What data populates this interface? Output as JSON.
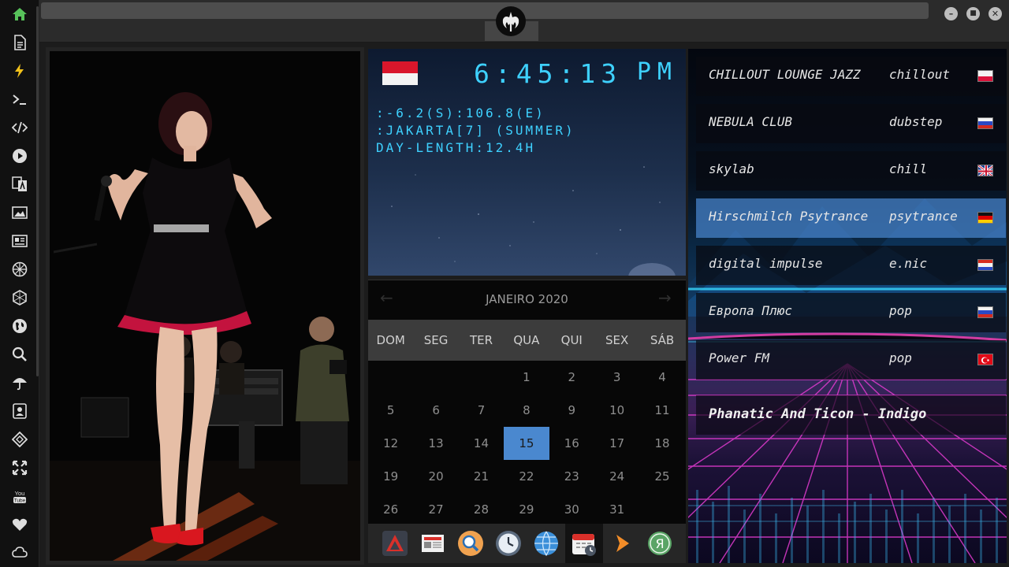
{
  "left_dock": {
    "icons": [
      "home-icon",
      "document-icon",
      "lightning-icon",
      "terminal-icon",
      "code-icon",
      "play-icon",
      "translate-icon",
      "image-icon",
      "news-icon",
      "aperture-icon",
      "hexagon-icon",
      "globe-icon",
      "search-icon",
      "umbrella-icon",
      "contact-card-icon",
      "tag-icon",
      "expand-icon",
      "youtube-icon",
      "heart-icon",
      "cloud-icon"
    ],
    "youtube_label": "You Tube"
  },
  "top_bar": {
    "window_buttons": [
      "minimize",
      "maximize",
      "close"
    ],
    "minimize_glyph": "–",
    "maximize_glyph": "■",
    "close_glyph": "✕"
  },
  "clock": {
    "time": "6:45:13",
    "ampm": "PM",
    "coords": ":-6.2(S):106.8(E)",
    "city": ":JAKARTA[7] (SUMMER)",
    "day_length": "DAY-LENGTH:12.4H",
    "flag": "indonesia",
    "digit_color": "#3ed1ff"
  },
  "calendar": {
    "title": "JANEIRO 2020",
    "prev_glyph": "←",
    "next_glyph": "→",
    "weekdays": [
      "DOM",
      "SEG",
      "TER",
      "QUA",
      "QUI",
      "SEX",
      "SÁB"
    ],
    "days": [
      "",
      "",
      "",
      "1",
      "2",
      "3",
      "4",
      "5",
      "6",
      "7",
      "8",
      "9",
      "10",
      "11",
      "12",
      "13",
      "14",
      "15",
      "16",
      "17",
      "18",
      "19",
      "20",
      "21",
      "22",
      "23",
      "24",
      "25",
      "26",
      "27",
      "28",
      "29",
      "30",
      "31",
      ""
    ],
    "today": "15",
    "today_color": "#4a88cf"
  },
  "app_dock": {
    "apps": [
      "red-triangle-app-icon",
      "newspaper-app-icon",
      "search-app-icon",
      "clock-app-icon",
      "globe-app-icon",
      "calendar-app-icon",
      "play-arrow-app-icon",
      "yandex-app-icon"
    ],
    "yandex_letter": "Я",
    "active": "calendar-app-icon"
  },
  "radio": {
    "stations": [
      {
        "name": "CHILLOUT LOUNGE JAZZ",
        "genre": "chillout",
        "flag": "poland"
      },
      {
        "name": "NEBULA CLUB",
        "genre": "dubstep",
        "flag": "russia"
      },
      {
        "name": "skylab",
        "genre": "chill",
        "flag": "uk"
      },
      {
        "name": "Hirschmilch Psytrance",
        "genre": "psytrance",
        "flag": "germany"
      },
      {
        "name": "digital impulse",
        "genre": "e.nic",
        "flag": "croatia"
      },
      {
        "name": "Европа Плюс",
        "genre": "pop",
        "flag": "russia"
      },
      {
        "name": "Power FM",
        "genre": "pop",
        "flag": "turkey"
      }
    ],
    "active_station": "Hirschmilch Psytrance",
    "now_playing": "Phanatic And Ticon - Indigo"
  }
}
